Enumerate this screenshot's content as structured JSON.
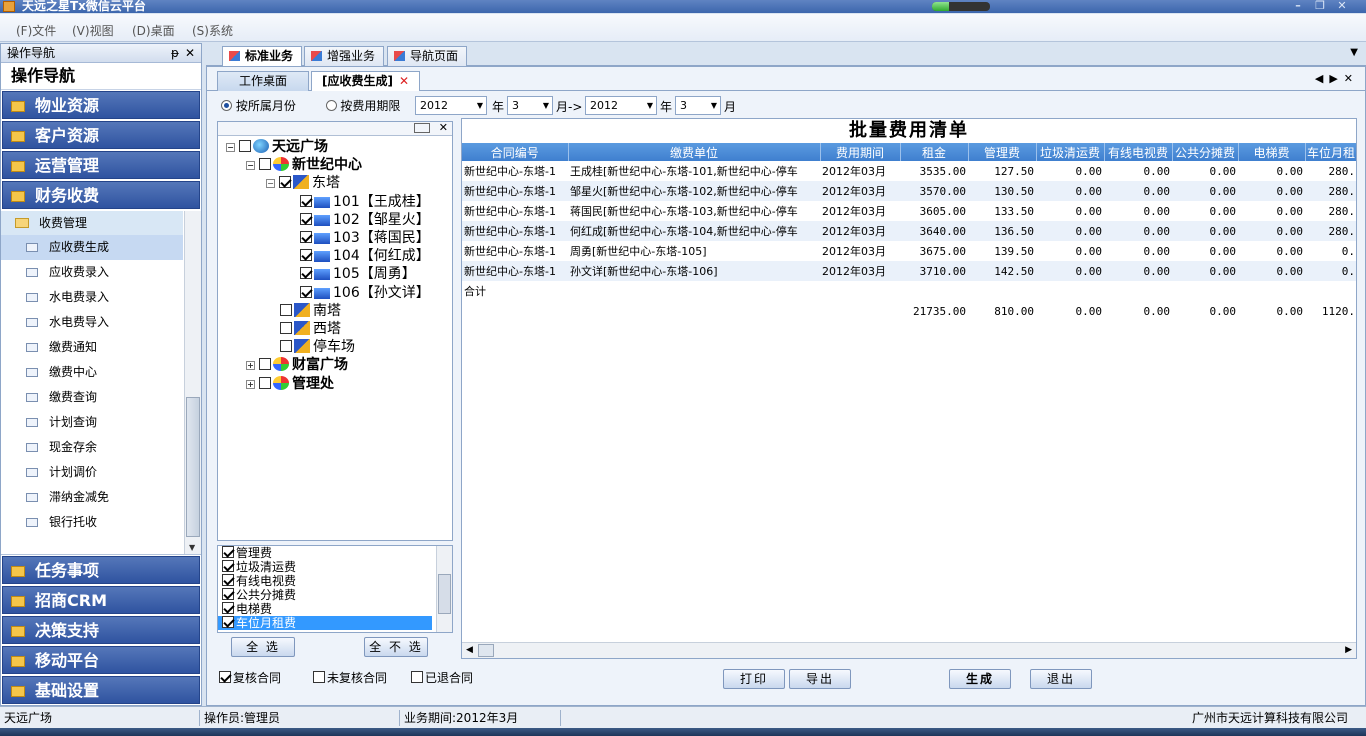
{
  "window": {
    "title": "天远之星Tx微信云平台"
  },
  "menu": [
    "(F)文件",
    "(V)视图",
    "(D)桌面",
    "(S)系统"
  ],
  "left_nav": {
    "header": "操作导航",
    "pin": "ᵽ",
    "close": "✕",
    "title": "操作导航",
    "groups_top": [
      "物业资源",
      "客户资源",
      "运营管理",
      "财务收费"
    ],
    "sub_header": "收费管理",
    "sub_items": [
      "应收费生成",
      "应收费录入",
      "水电费录入",
      "水电费导入",
      "缴费通知",
      "缴费中心",
      "缴费查询",
      "计划查询",
      "现金存余",
      "计划调价",
      "滞纳金减免",
      "银行托收"
    ],
    "groups_bottom": [
      "任务事项",
      "招商CRM",
      "决策支持",
      "移动平台",
      "基础设置"
    ]
  },
  "main_tabs": [
    "标准业务",
    "增强业务",
    "导航页面"
  ],
  "inner_tabs": [
    "工作桌面",
    "[应收费生成]"
  ],
  "filter": {
    "radio1": "按所属月份",
    "radio2": "按费用期限",
    "year1": "2012",
    "month1": "3",
    "year2": "2012",
    "month2": "3",
    "lbl_year": "年",
    "lbl_month_arrow": "月->",
    "lbl_month": "月"
  },
  "tree": [
    {
      "text": "天远广场",
      "bold": true,
      "checked": false,
      "icon": "globe",
      "pm": "−"
    },
    {
      "text": "新世纪中心",
      "bold": true,
      "checked": false,
      "icon": "multi",
      "pm": "−"
    },
    {
      "text": "东塔",
      "bold": false,
      "checked": true,
      "icon": "tower",
      "pm": "−"
    },
    {
      "text": "101【王成桂】",
      "bold": false,
      "checked": true,
      "icon": "room",
      "pm": ""
    },
    {
      "text": "102【邹星火】",
      "bold": false,
      "checked": true,
      "icon": "room",
      "pm": ""
    },
    {
      "text": "103【蒋国民】",
      "bold": false,
      "checked": true,
      "icon": "room",
      "pm": ""
    },
    {
      "text": "104【何红成】",
      "bold": false,
      "checked": true,
      "icon": "room",
      "pm": ""
    },
    {
      "text": "105【周勇】",
      "bold": false,
      "checked": true,
      "icon": "room",
      "pm": ""
    },
    {
      "text": "106【孙文详】",
      "bold": false,
      "checked": true,
      "icon": "room",
      "pm": ""
    },
    {
      "text": "南塔",
      "bold": false,
      "checked": false,
      "icon": "tower",
      "pm": ""
    },
    {
      "text": "西塔",
      "bold": false,
      "checked": false,
      "icon": "tower",
      "pm": ""
    },
    {
      "text": "停车场",
      "bold": false,
      "checked": false,
      "icon": "tower",
      "pm": ""
    },
    {
      "text": "财富广场",
      "bold": true,
      "checked": false,
      "icon": "multi",
      "pm": "+"
    },
    {
      "text": "管理处",
      "bold": true,
      "checked": false,
      "icon": "multi",
      "pm": "+"
    }
  ],
  "fees": [
    "管理费",
    "垃圾清运费",
    "有线电视费",
    "公共分摊费",
    "电梯费",
    "车位月租费"
  ],
  "buttons": {
    "select_all": "全 选",
    "select_none": "全 不 选",
    "print": "打印",
    "export": "导出",
    "generate": "生成",
    "exit": "退出"
  },
  "grid": {
    "title": "批量费用清单",
    "columns": [
      "合同编号",
      "缴费单位",
      "费用期间",
      "租金",
      "管理费",
      "垃圾清运费",
      "有线电视费",
      "公共分摊费",
      "电梯费",
      "车位月租"
    ],
    "rows": [
      [
        "新世纪中心-东塔-1",
        "王成桂[新世纪中心-东塔-101,新世纪中心-停车",
        "2012年03月",
        "3535.00",
        "127.50",
        "0.00",
        "0.00",
        "0.00",
        "0.00",
        "280."
      ],
      [
        "新世纪中心-东塔-1",
        "邹星火[新世纪中心-东塔-102,新世纪中心-停车",
        "2012年03月",
        "3570.00",
        "130.50",
        "0.00",
        "0.00",
        "0.00",
        "0.00",
        "280."
      ],
      [
        "新世纪中心-东塔-1",
        "蒋国民[新世纪中心-东塔-103,新世纪中心-停车",
        "2012年03月",
        "3605.00",
        "133.50",
        "0.00",
        "0.00",
        "0.00",
        "0.00",
        "280."
      ],
      [
        "新世纪中心-东塔-1",
        "何红成[新世纪中心-东塔-104,新世纪中心-停车",
        "2012年03月",
        "3640.00",
        "136.50",
        "0.00",
        "0.00",
        "0.00",
        "0.00",
        "280."
      ],
      [
        "新世纪中心-东塔-1",
        "周勇[新世纪中心-东塔-105]",
        "2012年03月",
        "3675.00",
        "139.50",
        "0.00",
        "0.00",
        "0.00",
        "0.00",
        "0."
      ],
      [
        "新世纪中心-东塔-1",
        "孙文详[新世纪中心-东塔-106]",
        "2012年03月",
        "3710.00",
        "142.50",
        "0.00",
        "0.00",
        "0.00",
        "0.00",
        "0."
      ]
    ],
    "total_label": "合计",
    "totals": [
      "21735.00",
      "810.00",
      "0.00",
      "0.00",
      "0.00",
      "0.00",
      "1120."
    ]
  },
  "checks": [
    {
      "label": "复核合同",
      "checked": true
    },
    {
      "label": "未复核合同",
      "checked": false
    },
    {
      "label": "已退合同",
      "checked": false
    }
  ],
  "status": {
    "place": "天远广场",
    "operator": "操作员:管理员",
    "period": "业务期间:2012年3月",
    "company": "广州市天远计算科技有限公司"
  }
}
